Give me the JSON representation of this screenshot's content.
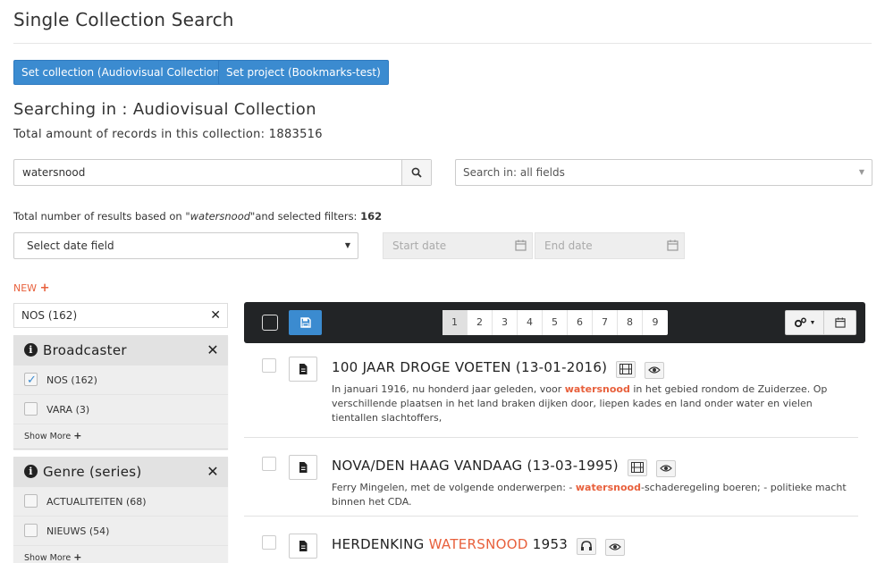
{
  "page_title": "Single Collection Search",
  "buttons": {
    "set_collection": "Set collection (Audiovisual Collection)",
    "set_project": "Set project (Bookmarks-test)"
  },
  "searching_in": "Searching in : Audiovisual Collection",
  "total_records": "Total amount of records in this collection: 1883516",
  "search": {
    "value": "watersnood",
    "field_select": "Search in: all fields"
  },
  "results_summary": {
    "prefix": "Total number of results based on ",
    "query": "\"watersnood\"",
    "middle": "and selected filters: ",
    "count": "162"
  },
  "date_filter": {
    "select_label": "Select date field",
    "start_placeholder": "Start date",
    "end_placeholder": "End date"
  },
  "new_label": "NEW",
  "active_filter": "NOS (162)",
  "facets": {
    "broadcaster": {
      "title": "Broadcaster",
      "options": [
        {
          "label": "NOS (162)",
          "checked": true
        },
        {
          "label": "VARA (3)",
          "checked": false
        }
      ],
      "show_more": "Show More"
    },
    "genre": {
      "title": "Genre (series)",
      "options": [
        {
          "label": "ACTUALITEITEN (68)",
          "checked": false
        },
        {
          "label": "NIEUWS (54)",
          "checked": false
        }
      ],
      "show_more": "Show More"
    }
  },
  "pagination": [
    "1",
    "2",
    "3",
    "4",
    "5",
    "6",
    "7",
    "8",
    "9"
  ],
  "current_page": "1",
  "results": [
    {
      "title": "100 JAAR DROGE VOETEN (13-01-2016)",
      "media_icon": "film-icon",
      "desc_before": "In januari 1916, nu honderd jaar geleden, voor ",
      "desc_highlight": "watersnood",
      "desc_after": " in het gebied rondom de Zuiderzee. Op verschillende plaatsen in het land braken dijken door, liepen kades en land onder water en vielen tientallen slachtoffers,"
    },
    {
      "title": "NOVA/DEN HAAG VANDAAG (13-03-1995)",
      "media_icon": "film-icon",
      "desc_before": "Ferry Mingelen, met de volgende onderwerpen: - ",
      "desc_highlight": "watersnood",
      "desc_after": "-schaderegeling boeren; - politieke macht binnen het CDA."
    },
    {
      "title_before": "HERDENKING ",
      "title_highlight": "WATERSNOOD",
      "title_after": " 1953",
      "media_icon": "headphones-icon"
    }
  ],
  "colors": {
    "accent_blue": "#3b8bd0",
    "highlight_orange": "#e8603c",
    "toolbar_dark": "#222426"
  }
}
